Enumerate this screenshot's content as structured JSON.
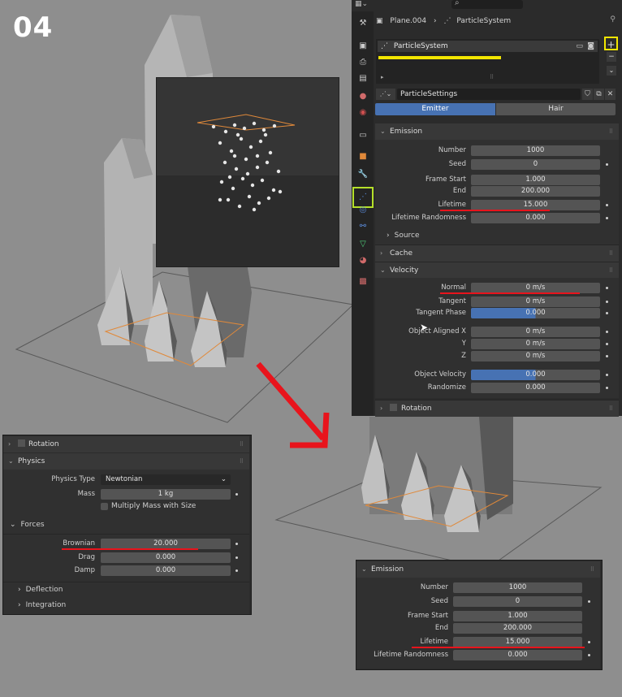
{
  "step_label": "04",
  "header": {
    "object": "Plane.004",
    "system": "ParticleSystem"
  },
  "particle_list": {
    "item": "ParticleSystem"
  },
  "settings": {
    "name": "ParticleSettings"
  },
  "type_tabs": [
    "Emitter",
    "Hair"
  ],
  "emission": {
    "title": "Emission",
    "rows": [
      {
        "label": "Number",
        "value": "1000"
      },
      {
        "label": "Seed",
        "value": "0"
      },
      {
        "label": "Frame Start",
        "value": "1.000"
      },
      {
        "label": "End",
        "value": "200.000"
      },
      {
        "label": "Lifetime",
        "value": "15.000"
      },
      {
        "label": "Lifetime Randomness",
        "value": "0.000"
      }
    ],
    "source": "Source"
  },
  "cache": "Cache",
  "velocity": {
    "title": "Velocity",
    "rows": [
      {
        "label": "Normal",
        "value": "0 m/s"
      },
      {
        "label": "Tangent",
        "value": "0 m/s"
      },
      {
        "label": "Tangent Phase",
        "value": "0.000"
      },
      {
        "label": "Object Aligned X",
        "value": "0 m/s"
      },
      {
        "label": "Y",
        "value": "0 m/s"
      },
      {
        "label": "Z",
        "value": "0 m/s"
      },
      {
        "label": "Object Velocity",
        "value": "0.000"
      },
      {
        "label": "Randomize",
        "value": "0.000"
      }
    ]
  },
  "rotation": "Rotation",
  "physics_panel": {
    "rotation": "Rotation",
    "physics": "Physics",
    "physics_type_label": "Physics Type",
    "physics_type_value": "Newtonian",
    "mass_label": "Mass",
    "mass_value": "1 kg",
    "multiply_mass": "Multiply Mass with Size",
    "forces": "Forces",
    "brownian_label": "Brownian",
    "brownian_value": "20.000",
    "drag_label": "Drag",
    "drag_value": "0.000",
    "damp_label": "Damp",
    "damp_value": "0.000",
    "deflection": "Deflection",
    "integration": "Integration"
  },
  "emission_panel2": {
    "title": "Emission",
    "rows": [
      {
        "label": "Number",
        "value": "1000"
      },
      {
        "label": "Seed",
        "value": "0"
      },
      {
        "label": "Frame Start",
        "value": "1.000"
      },
      {
        "label": "End",
        "value": "200.000"
      },
      {
        "label": "Lifetime",
        "value": "15.000"
      },
      {
        "label": "Lifetime Randomness",
        "value": "0.000"
      }
    ]
  },
  "colors": {
    "accent_blue": "#4772b3",
    "highlight_yellow": "#f2e600",
    "annotation_red": "#e8141c",
    "outline_orange": "#e0893a"
  }
}
